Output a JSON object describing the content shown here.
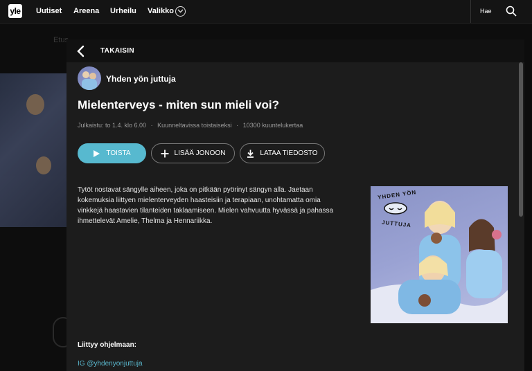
{
  "nav": {
    "logo": "yle",
    "items": [
      "Uutiset",
      "Areena",
      "Urheilu",
      "Valikko"
    ],
    "search_label": "Hae"
  },
  "background": {
    "subnav": [
      "Etus"
    ]
  },
  "modal": {
    "back_label": "TAKAISIN",
    "series_name": "Yhden yön juttuja",
    "episode_title": "Mielenterveys - miten sun mieli voi?",
    "meta": {
      "published": "Julkaistu: to 1.4. klo 6.00",
      "availability": "Kuunneltavissa toistaiseksi",
      "listens": "10300 kuuntelukertaa"
    },
    "buttons": {
      "play": "TOISTA",
      "queue": "LISÄÄ JONOON",
      "download": "LATAA TIEDOSTO"
    },
    "description": "Tytöt nostavat sängylle aiheen, joka on pitkään pyörinyt sängyn alla. Jaetaan kokemuksia liittyen mielenterveyden haasteisiin ja terapiaan, unohtamatta omia vinkkejä haastavien tilanteiden taklaamiseen. Mielen vahvuutta hyvässä ja pahassa ihmettelevät Amelie, Thelma ja Hennariikka.",
    "cover_text": [
      "YHDEN YÖN",
      "JUTTUJA"
    ],
    "related_heading": "Liittyy ohjelmaan:",
    "related_link": "IG @yhdenyonjuttuja"
  },
  "colors": {
    "accent": "#57b9cf",
    "link": "#5ab7cd",
    "modal_bg": "#1c1c1c",
    "page_bg": "#0d0d0d"
  }
}
